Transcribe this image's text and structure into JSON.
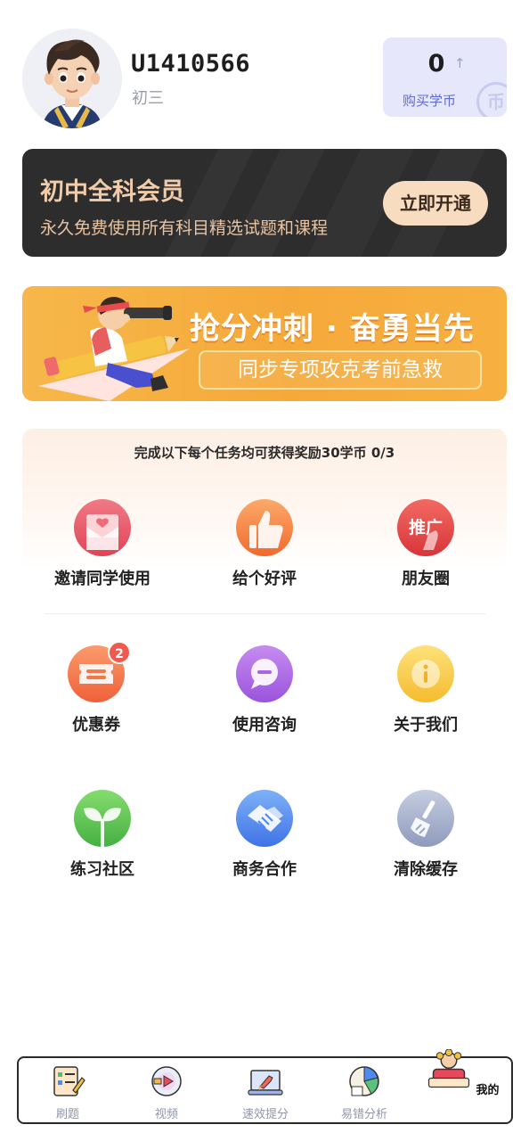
{
  "profile": {
    "username": "U1410566",
    "grade": "初三",
    "coins": "0",
    "coin_arrow": "↑",
    "buy_coins_label": "购买学币",
    "coin_watermark": "币"
  },
  "vip": {
    "title": "初中全科会员",
    "subtitle": "永久免费使用所有科目精选试题和课程",
    "button": "立即开通"
  },
  "promo": {
    "title": "抢分冲刺 · 奋勇当先",
    "subtitle": "同步专项攻克考前急救"
  },
  "tasks": {
    "header": "完成以下每个任务均可获得奖励30学币 0/3",
    "items": [
      {
        "label": "邀请同学使用",
        "icon": "invite-envelope-icon",
        "color": "#e8495a"
      },
      {
        "label": "给个好评",
        "icon": "thumbs-up-icon",
        "color": "#f5783a"
      },
      {
        "label": "朋友圈",
        "icon": "share-promote-icon",
        "color": "#e84646",
        "icon_text": "推广"
      }
    ]
  },
  "menu": {
    "items": [
      {
        "label": "优惠券",
        "icon": "coupon-icon",
        "color": "#f37a4a",
        "badge": "2"
      },
      {
        "label": "使用咨询",
        "icon": "chat-bubble-icon",
        "color": "#a662e0"
      },
      {
        "label": "关于我们",
        "icon": "info-icon",
        "color": "#f7c948"
      },
      {
        "label": "练习社区",
        "icon": "sprout-icon",
        "color": "#5cc25a"
      },
      {
        "label": "商务合作",
        "icon": "handshake-icon",
        "color": "#4f86ee"
      },
      {
        "label": "清除缓存",
        "icon": "broom-icon",
        "color": "#9aa6c4"
      }
    ]
  },
  "tabbar": {
    "tabs": [
      {
        "label": "刷题",
        "icon": "clipboard-icon"
      },
      {
        "label": "视频",
        "icon": "video-disc-icon"
      },
      {
        "label": "速效提分",
        "icon": "rocket-laptop-icon"
      },
      {
        "label": "易错分析",
        "icon": "pie-chart-icon"
      },
      {
        "label": "我的",
        "icon": "profile-crown-icon",
        "active": true
      }
    ]
  }
}
